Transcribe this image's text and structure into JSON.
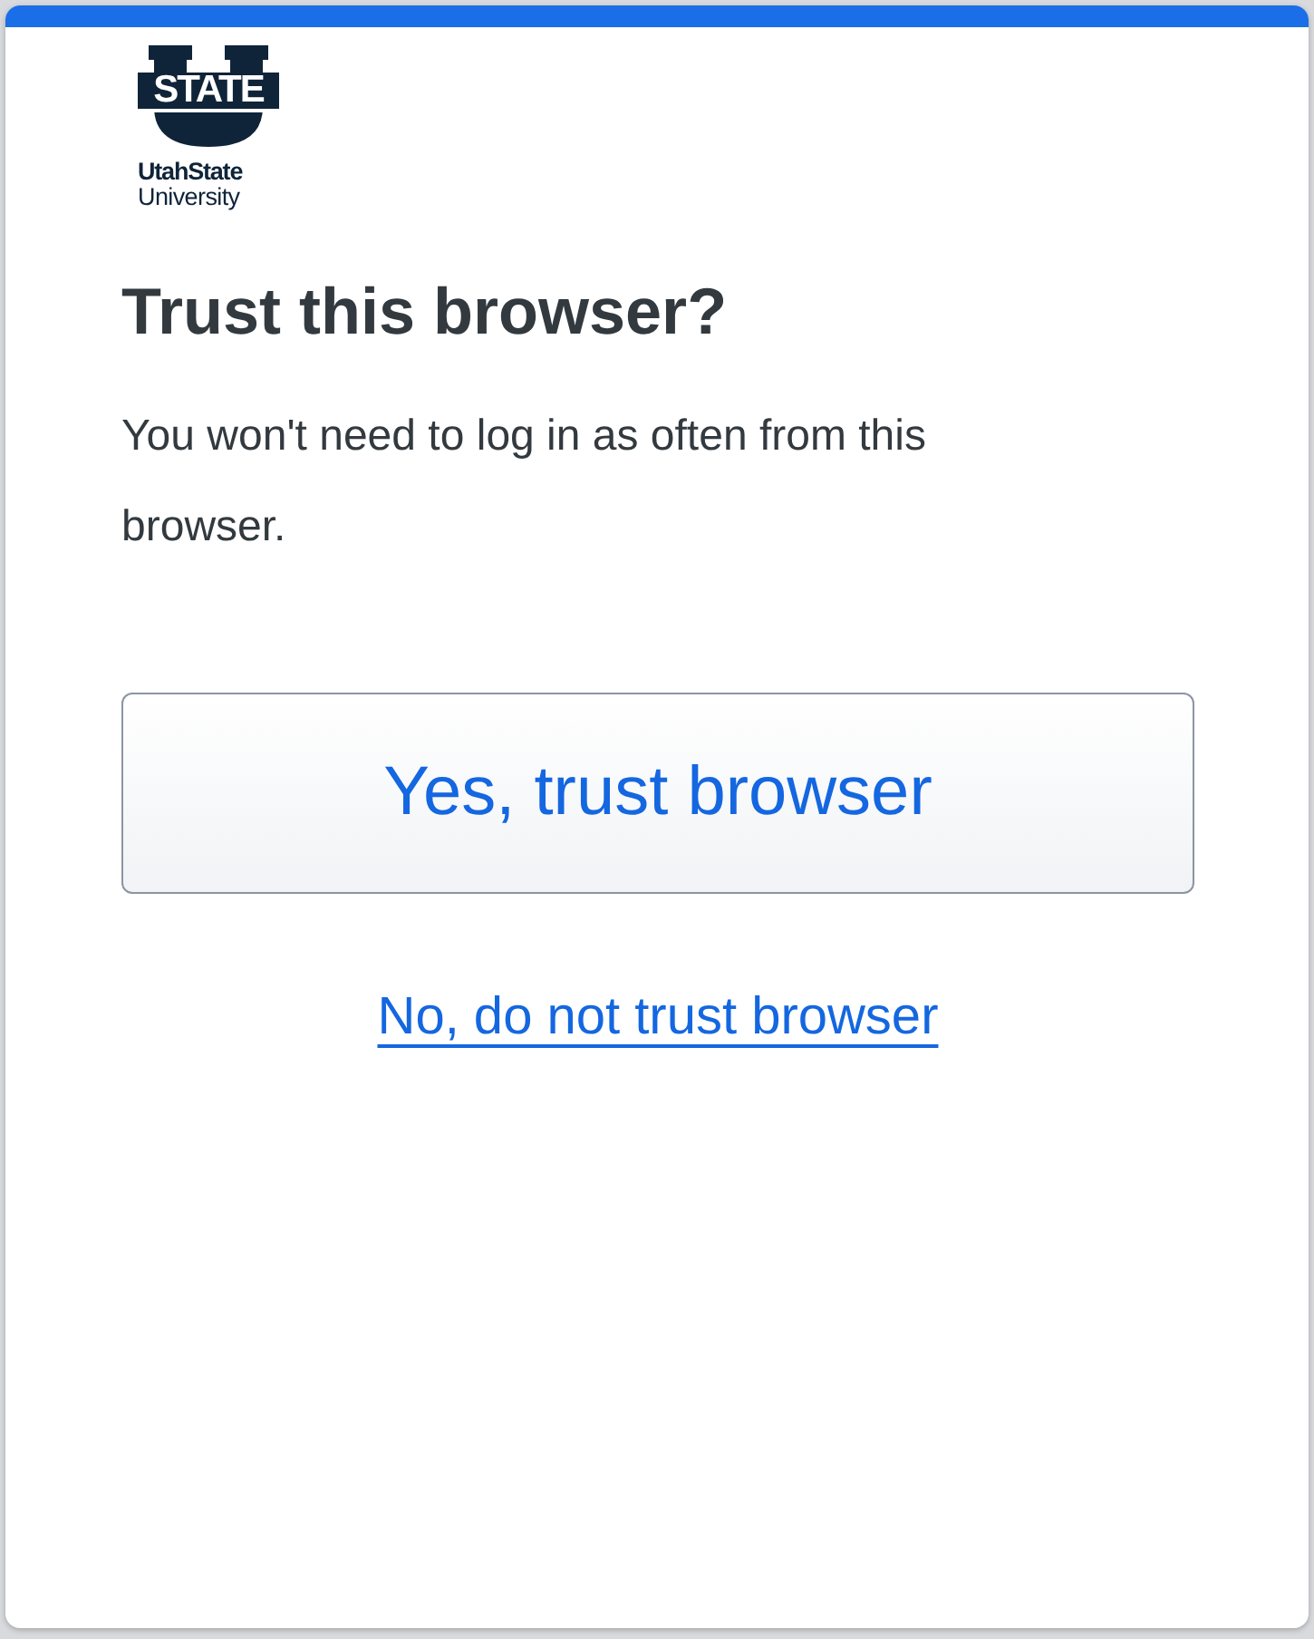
{
  "logo": {
    "mark": "STATE",
    "name_lines": [
      "UtahState",
      "University"
    ]
  },
  "title": "Trust this browser?",
  "message": "You won't need to log in as often from this browser.",
  "primary_button": "Yes, trust browser",
  "secondary_link": "No, do not trust browser"
}
